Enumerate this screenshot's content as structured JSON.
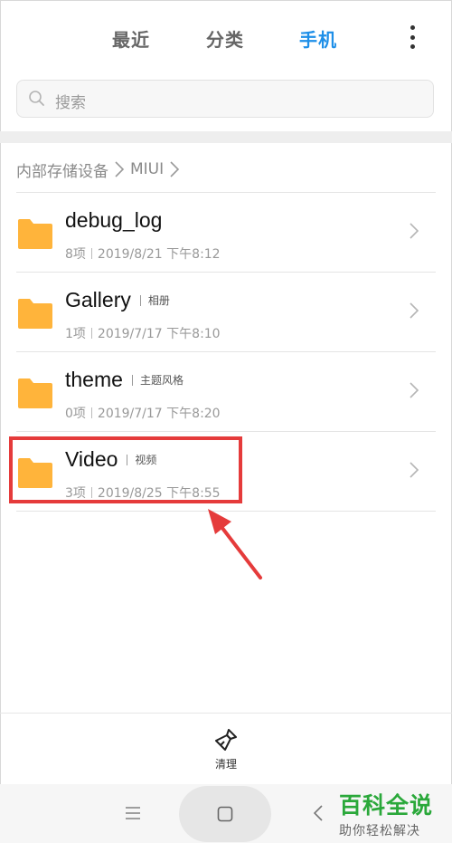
{
  "tabs": {
    "recent": "最近",
    "category": "分类",
    "phone": "手机"
  },
  "search": {
    "placeholder": "搜索"
  },
  "breadcrumb": {
    "root": "内部存储设备",
    "current": "MIUI"
  },
  "folders": [
    {
      "name": "debug_log",
      "alias": "",
      "count": "8项",
      "date": "2019/8/21 下午8:12"
    },
    {
      "name": "Gallery",
      "alias": "相册",
      "count": "1项",
      "date": "2019/7/17 下午8:10"
    },
    {
      "name": "theme",
      "alias": "主题风格",
      "count": "0项",
      "date": "2019/7/17 下午8:20"
    },
    {
      "name": "Video",
      "alias": "视频",
      "count": "3项",
      "date": "2019/8/25 下午8:55"
    }
  ],
  "bottom": {
    "clean_label": "清理"
  },
  "watermark": {
    "title": "百科全说",
    "subtitle": "助你轻松解决"
  },
  "colors": {
    "accent": "#1e8fe8",
    "folder": "#ffb43b",
    "highlight": "#e53b3b"
  }
}
